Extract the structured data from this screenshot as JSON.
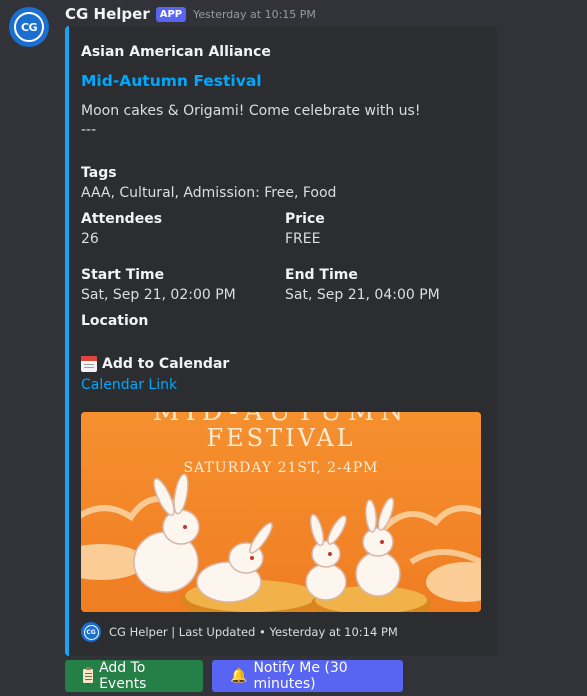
{
  "message": {
    "avatar_initials": "CG",
    "username": "CG Helper",
    "badge": "APP",
    "timestamp": "Yesterday at 10:15 PM"
  },
  "embed": {
    "accent_color": "#1da1f2",
    "author": "Asian American Alliance",
    "title": "Mid-Autumn Festival",
    "description_line1": "Moon cakes & Origami! Come celebrate with us!",
    "description_line2": "---",
    "fields": {
      "tags": {
        "name": "Tags",
        "value": "AAA, Cultural, Admission: Free, Food"
      },
      "attendees": {
        "name": "Attendees",
        "value": "26"
      },
      "price": {
        "name": "Price",
        "value": "FREE"
      },
      "start_time": {
        "name": "Start Time",
        "value": "Sat, Sep 21, 02:00 PM"
      },
      "end_time": {
        "name": "End Time",
        "value": "Sat, Sep 21, 04:00 PM"
      },
      "location": {
        "name": "Location",
        "value": ""
      }
    },
    "calendar": {
      "icon": "calendar-icon",
      "title": "Add to Calendar",
      "link_text": "Calendar Link"
    },
    "image": {
      "heading_partial": "MID-AUTUMN",
      "heading": "FESTIVAL",
      "subheading": "SATURDAY 21ST, 2-4PM"
    },
    "footer": {
      "avatar_initials": "CG",
      "text": "CG Helper | Last Updated • Yesterday at 10:14 PM"
    }
  },
  "buttons": [
    {
      "label": "Add To Events",
      "icon": "clipboard-icon",
      "color": "#248046"
    },
    {
      "label": "Notify Me (30 minutes)",
      "icon": "bell-icon",
      "color": "#5865f2"
    }
  ]
}
